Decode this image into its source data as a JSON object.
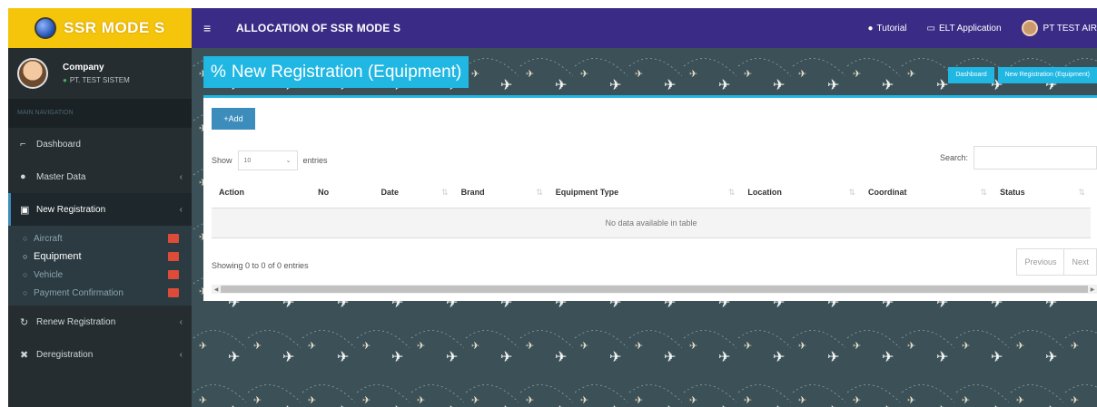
{
  "brand": {
    "text": "SSR MODE S"
  },
  "topbar": {
    "menu_icon": "hamburger-icon",
    "title": "ALLOCATION OF SSR MODE S",
    "tutorial": "Tutorial",
    "elt": "ELT Application",
    "user": "PT TEST AIR"
  },
  "sidebar": {
    "company": "Company",
    "org": "PT. TEST SISTEM",
    "nav_header": "MAIN NAVIGATION",
    "items": [
      {
        "label": "Dashboard",
        "icon": "chart-icon"
      },
      {
        "label": "Master Data",
        "icon": "database-icon"
      },
      {
        "label": "New Registration",
        "icon": "file-icon"
      },
      {
        "label": "Renew Registration",
        "icon": "refresh-icon"
      },
      {
        "label": "Deregistration",
        "icon": "close-icon"
      }
    ],
    "sub_items": [
      {
        "label": "Aircraft"
      },
      {
        "label": "Equipment"
      },
      {
        "label": "Vehicle"
      },
      {
        "label": "Payment Confirmation"
      }
    ]
  },
  "page": {
    "title": "New Registration (Equipment)",
    "breadcrumb": [
      "Dashboard",
      "New Registration (Equipment)"
    ]
  },
  "table": {
    "add_label": "Add",
    "show_label": "Show",
    "entries_value": "10",
    "entries_label": "entries",
    "search_label": "Search:",
    "columns": [
      "Action",
      "No",
      "Date",
      "Brand",
      "Equipment Type",
      "Location",
      "Coordinat",
      "Status"
    ],
    "empty_text": "No data available in table",
    "info": "Showing 0 to 0 of 0 entries",
    "prev": "Previous",
    "next": "Next"
  }
}
